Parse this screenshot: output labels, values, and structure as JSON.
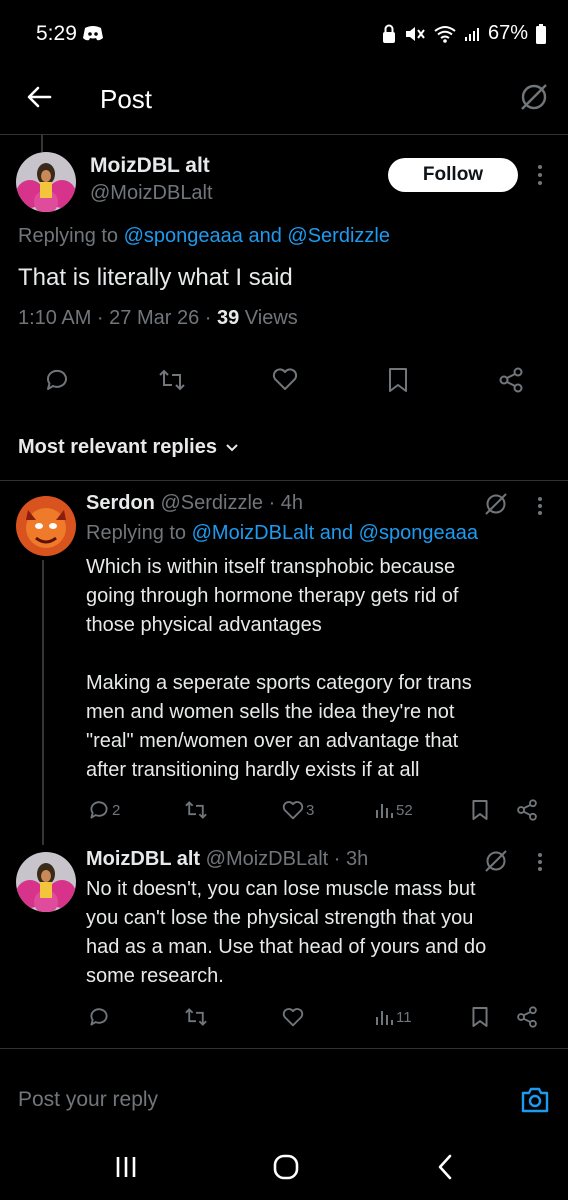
{
  "status_bar": {
    "time": "5:29",
    "battery": "67%"
  },
  "header": {
    "title": "Post"
  },
  "main_post": {
    "display_name": "MoizDBL alt",
    "handle": "@MoizDBLalt",
    "follow_label": "Follow",
    "replying_prefix": "Replying to",
    "replying_to": "@spongeaaa and @Serdizzle",
    "text": "That is literally what I said",
    "time": "1:10 AM · 27 Mar 26 ·",
    "views_count": "39",
    "views_label": "Views"
  },
  "replies_section": {
    "title": "Most relevant replies"
  },
  "replies": [
    {
      "display_name": "Serdon",
      "handle": "@Serdizzle · 4h",
      "replying_prefix": "Replying to",
      "replying_to": "@MoizDBLalt and @spongeaaa",
      "text_lines": [
        "Which is within itself transphobic because",
        "going through hormone therapy gets rid of",
        "those physical advantages",
        "",
        "Making a seperate sports category for trans",
        "men and women sells the idea they're not",
        "\"real\" men/women over an advantage that",
        "after transitioning hardly exists if at all"
      ],
      "replies_count": "2",
      "likes_count": "3",
      "views_count": "52"
    },
    {
      "display_name": "MoizDBL alt",
      "handle": "@MoizDBLalt · 3h",
      "text_lines": [
        "No it doesn't, you can lose muscle mass but",
        "you can't lose the physical strength that you",
        "had as a man. Use that head of yours and do",
        "some research."
      ],
      "views_count": "11"
    }
  ],
  "composer": {
    "placeholder": "Post your reply"
  },
  "colors": {
    "accent": "#1d9bf0",
    "muted": "#71767b",
    "text": "#e7e9ea"
  }
}
